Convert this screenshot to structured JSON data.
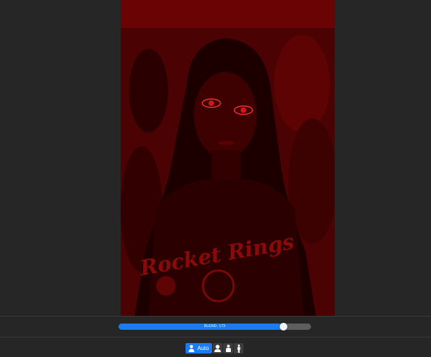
{
  "editor": {
    "blend": {
      "label": "BLEND: 173",
      "fraction": 0.855
    },
    "modes": {
      "active_label": "Auto",
      "items": [
        {
          "name": "auto",
          "label": "Auto",
          "icon": "person-icon",
          "active": true
        },
        {
          "name": "head",
          "icon": "person-head-icon",
          "active": false
        },
        {
          "name": "half-body",
          "icon": "person-half-icon",
          "active": false
        },
        {
          "name": "full-body",
          "icon": "person-full-icon",
          "active": false
        }
      ]
    },
    "photo": {
      "shirt_text": "Rocket Rings"
    }
  },
  "colors": {
    "accent": "#1a7cf0",
    "track": "#5e5e5e",
    "background": "#262626",
    "photo_tint": "#6e0606"
  }
}
